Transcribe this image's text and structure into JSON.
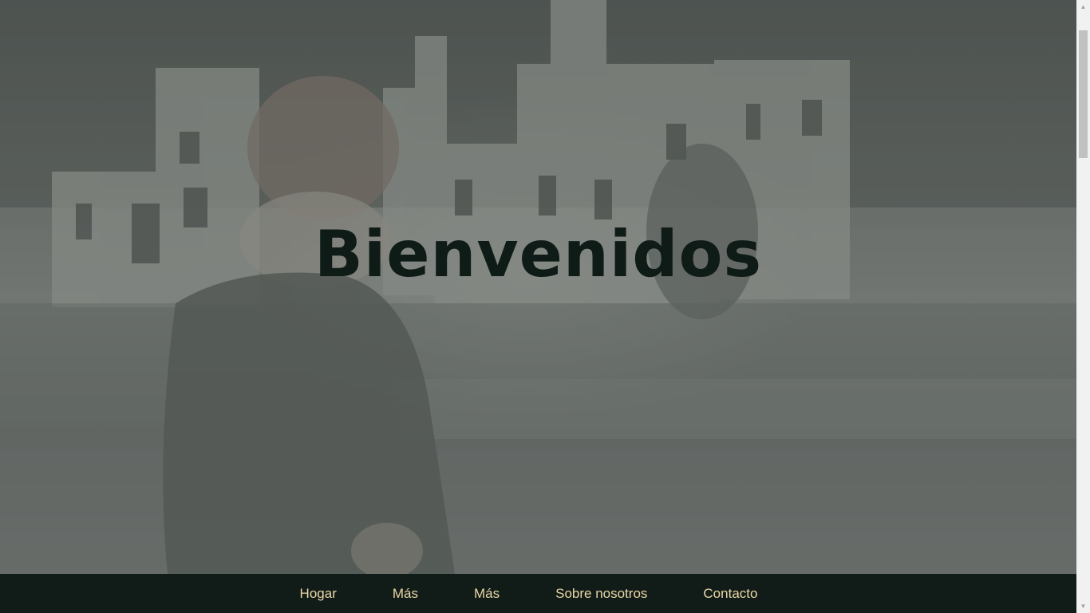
{
  "hero": {
    "title": "Bienvenidos",
    "background_image": "misty-castle-with-person-in-foreground"
  },
  "nav": {
    "items": [
      {
        "label": "Hogar"
      },
      {
        "label": "Más"
      },
      {
        "label": "Más"
      },
      {
        "label": "Sobre nosotros"
      },
      {
        "label": "Contacto"
      }
    ]
  },
  "colors": {
    "nav_background": "#111c18",
    "nav_text": "#e9d6a6",
    "title_text": "#0f1b17"
  },
  "scrollbar": {
    "up_icon": "arrow-up-icon",
    "down_icon": "arrow-down-icon"
  }
}
